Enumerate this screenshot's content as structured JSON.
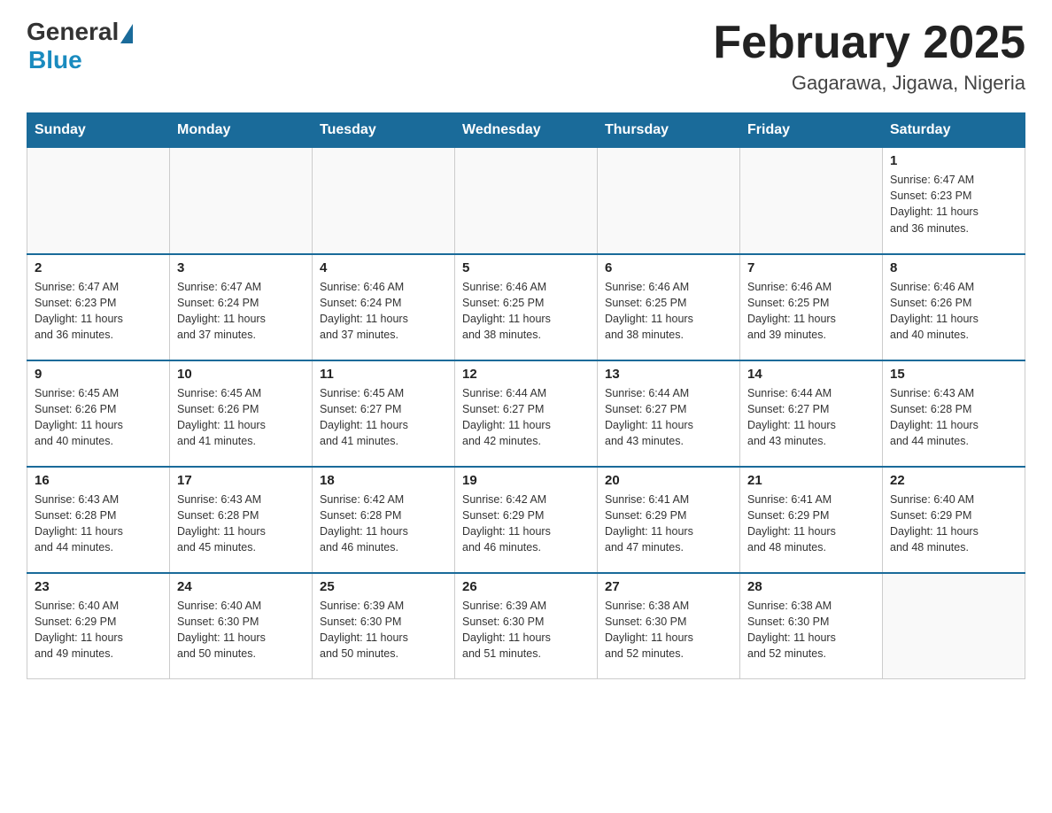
{
  "header": {
    "logo_general": "General",
    "logo_blue": "Blue",
    "title": "February 2025",
    "subtitle": "Gagarawa, Jigawa, Nigeria"
  },
  "calendar": {
    "days_of_week": [
      "Sunday",
      "Monday",
      "Tuesday",
      "Wednesday",
      "Thursday",
      "Friday",
      "Saturday"
    ],
    "weeks": [
      [
        {
          "day": "",
          "info": ""
        },
        {
          "day": "",
          "info": ""
        },
        {
          "day": "",
          "info": ""
        },
        {
          "day": "",
          "info": ""
        },
        {
          "day": "",
          "info": ""
        },
        {
          "day": "",
          "info": ""
        },
        {
          "day": "1",
          "info": "Sunrise: 6:47 AM\nSunset: 6:23 PM\nDaylight: 11 hours\nand 36 minutes."
        }
      ],
      [
        {
          "day": "2",
          "info": "Sunrise: 6:47 AM\nSunset: 6:23 PM\nDaylight: 11 hours\nand 36 minutes."
        },
        {
          "day": "3",
          "info": "Sunrise: 6:47 AM\nSunset: 6:24 PM\nDaylight: 11 hours\nand 37 minutes."
        },
        {
          "day": "4",
          "info": "Sunrise: 6:46 AM\nSunset: 6:24 PM\nDaylight: 11 hours\nand 37 minutes."
        },
        {
          "day": "5",
          "info": "Sunrise: 6:46 AM\nSunset: 6:25 PM\nDaylight: 11 hours\nand 38 minutes."
        },
        {
          "day": "6",
          "info": "Sunrise: 6:46 AM\nSunset: 6:25 PM\nDaylight: 11 hours\nand 38 minutes."
        },
        {
          "day": "7",
          "info": "Sunrise: 6:46 AM\nSunset: 6:25 PM\nDaylight: 11 hours\nand 39 minutes."
        },
        {
          "day": "8",
          "info": "Sunrise: 6:46 AM\nSunset: 6:26 PM\nDaylight: 11 hours\nand 40 minutes."
        }
      ],
      [
        {
          "day": "9",
          "info": "Sunrise: 6:45 AM\nSunset: 6:26 PM\nDaylight: 11 hours\nand 40 minutes."
        },
        {
          "day": "10",
          "info": "Sunrise: 6:45 AM\nSunset: 6:26 PM\nDaylight: 11 hours\nand 41 minutes."
        },
        {
          "day": "11",
          "info": "Sunrise: 6:45 AM\nSunset: 6:27 PM\nDaylight: 11 hours\nand 41 minutes."
        },
        {
          "day": "12",
          "info": "Sunrise: 6:44 AM\nSunset: 6:27 PM\nDaylight: 11 hours\nand 42 minutes."
        },
        {
          "day": "13",
          "info": "Sunrise: 6:44 AM\nSunset: 6:27 PM\nDaylight: 11 hours\nand 43 minutes."
        },
        {
          "day": "14",
          "info": "Sunrise: 6:44 AM\nSunset: 6:27 PM\nDaylight: 11 hours\nand 43 minutes."
        },
        {
          "day": "15",
          "info": "Sunrise: 6:43 AM\nSunset: 6:28 PM\nDaylight: 11 hours\nand 44 minutes."
        }
      ],
      [
        {
          "day": "16",
          "info": "Sunrise: 6:43 AM\nSunset: 6:28 PM\nDaylight: 11 hours\nand 44 minutes."
        },
        {
          "day": "17",
          "info": "Sunrise: 6:43 AM\nSunset: 6:28 PM\nDaylight: 11 hours\nand 45 minutes."
        },
        {
          "day": "18",
          "info": "Sunrise: 6:42 AM\nSunset: 6:28 PM\nDaylight: 11 hours\nand 46 minutes."
        },
        {
          "day": "19",
          "info": "Sunrise: 6:42 AM\nSunset: 6:29 PM\nDaylight: 11 hours\nand 46 minutes."
        },
        {
          "day": "20",
          "info": "Sunrise: 6:41 AM\nSunset: 6:29 PM\nDaylight: 11 hours\nand 47 minutes."
        },
        {
          "day": "21",
          "info": "Sunrise: 6:41 AM\nSunset: 6:29 PM\nDaylight: 11 hours\nand 48 minutes."
        },
        {
          "day": "22",
          "info": "Sunrise: 6:40 AM\nSunset: 6:29 PM\nDaylight: 11 hours\nand 48 minutes."
        }
      ],
      [
        {
          "day": "23",
          "info": "Sunrise: 6:40 AM\nSunset: 6:29 PM\nDaylight: 11 hours\nand 49 minutes."
        },
        {
          "day": "24",
          "info": "Sunrise: 6:40 AM\nSunset: 6:30 PM\nDaylight: 11 hours\nand 50 minutes."
        },
        {
          "day": "25",
          "info": "Sunrise: 6:39 AM\nSunset: 6:30 PM\nDaylight: 11 hours\nand 50 minutes."
        },
        {
          "day": "26",
          "info": "Sunrise: 6:39 AM\nSunset: 6:30 PM\nDaylight: 11 hours\nand 51 minutes."
        },
        {
          "day": "27",
          "info": "Sunrise: 6:38 AM\nSunset: 6:30 PM\nDaylight: 11 hours\nand 52 minutes."
        },
        {
          "day": "28",
          "info": "Sunrise: 6:38 AM\nSunset: 6:30 PM\nDaylight: 11 hours\nand 52 minutes."
        },
        {
          "day": "",
          "info": ""
        }
      ]
    ]
  }
}
